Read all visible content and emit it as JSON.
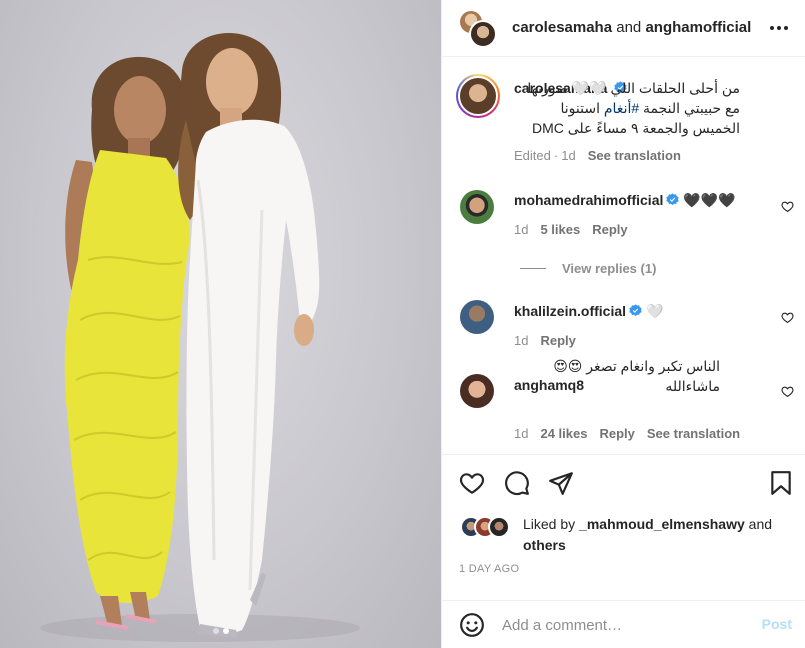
{
  "header": {
    "user1": "carolesamaha",
    "joiner": " and ",
    "user2": "anghamofficial"
  },
  "caption": {
    "username": "carolesamaha",
    "text_before_hashtag": "من أحلى الحلقات اللي 🤍🤍 صورتها مع حبيبتي النجمة ",
    "hashtag": "#أنغام",
    "text_after_hashtag": " استنونا الخميس والجمعة ٩ مساءً على DMC",
    "edited": "Edited",
    "time": "1d",
    "see_translation": "See translation"
  },
  "comments": [
    {
      "username": "mohamedrahimofficial",
      "text": "🖤🖤🖤",
      "time": "1d",
      "likes": "5 likes",
      "reply": "Reply",
      "view_replies": "View replies (1)"
    },
    {
      "username": "khalilzein.official",
      "text": "🤍",
      "time": "1d",
      "reply": "Reply"
    },
    {
      "username": "anghamq8",
      "text": "الناس تكبر وانغام تصغر 😍😍 ماشاءالله",
      "time": "1d",
      "likes": "24 likes",
      "reply": "Reply",
      "see_translation": "See translation"
    }
  ],
  "likes": {
    "prefix": "Liked by ",
    "user": "_mahmoud_elmenshawy",
    "joiner": " and ",
    "others": "others"
  },
  "timestamp": "1 DAY AGO",
  "add_comment": {
    "placeholder": "Add a comment…",
    "post_label": "Post"
  },
  "icons": [
    "more-icon",
    "verified-icon",
    "heart-icon",
    "comment-icon",
    "share-icon",
    "bookmark-icon",
    "emoji-icon"
  ],
  "colors": {
    "dress_yellow": "#e8e43a",
    "dress_white": "#f7f6f4",
    "verified_blue": "#3897f0",
    "post_disabled": "#b2dffc",
    "hashtag": "#00376b"
  },
  "carousel": {
    "total": 2,
    "active": 2
  }
}
